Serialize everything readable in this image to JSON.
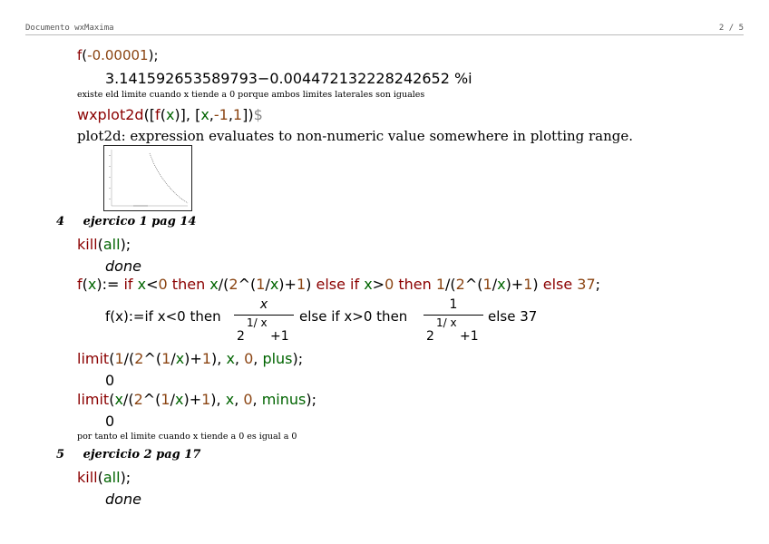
{
  "header": {
    "title": "Documento wxMaxima",
    "page": "2 / 5"
  },
  "cell1": {
    "input": {
      "fn": "f",
      "p1": "(",
      "neg": "-",
      "num": "0.00001",
      "p2": ");"
    },
    "output": "3.141592653589793−0.004472132228242652 %i"
  },
  "comment1": "existe eld limite cuando x tiende a 0 porque ambos limites laterales son iguales",
  "cell2": {
    "input": {
      "fn": "wxplot2d",
      "a": "([",
      "f": "f",
      "b": "(",
      "x": "x",
      "c": ")], [",
      "x2": "x",
      "d": ",",
      "n1": "-1",
      "e": ",",
      "n2": "1",
      "g": "])",
      "dollar": "$"
    },
    "message": "plot2d: expression evaluates to non-numeric value somewhere in plotting range."
  },
  "section4": {
    "number": "4",
    "title": "ejercico 1  pag 14"
  },
  "cell3": {
    "input": {
      "fn": "kill",
      "p1": "(",
      "arg": "all",
      "p2": ");"
    },
    "output": "done"
  },
  "cell4": {
    "input": {
      "t1": "f",
      "t2": "(",
      "t3": "x",
      "t4": "):= ",
      "t5": "if",
      "t6": " ",
      "t7": "x",
      "t8": "<",
      "t9": "0",
      "t10": " then ",
      "t11": "x",
      "t12": "/(",
      "t13": "2",
      "t14": "^(",
      "t15": "1",
      "t16": "/",
      "t17": "x",
      "t18": ")+",
      "t19": "1",
      "t20": ") ",
      "t21": "else if",
      "t22": " ",
      "t23": "x",
      "t24": ">",
      "t25": "0",
      "t26": " then ",
      "t27": "1",
      "t28": "/(",
      "t29": "2",
      "t30": "^(",
      "t31": "1",
      "t32": "/",
      "t33": "x",
      "t34": ")+",
      "t35": "1",
      "t36": ") ",
      "t37": "else ",
      "t38": "37",
      "t39": ";"
    },
    "output": {
      "lhs": "f(x):=if x<0 then",
      "frac1_num": "x",
      "frac1_base": "2",
      "frac1_exp": "1/ x",
      "frac1_plus": "+1",
      "mid": "else if x>0 then",
      "frac2_num": "1",
      "frac2_base": "2",
      "frac2_exp": "1/ x",
      "frac2_plus": "+1",
      "rhs": "else 37"
    }
  },
  "cell5": {
    "input": {
      "fn": "limit",
      "a": "(",
      "n1": "1",
      "b": "/(",
      "n2": "2",
      "c": "^(",
      "n3": "1",
      "d": "/",
      "x": "x",
      "e": ")+",
      "n4": "1",
      "f": "), ",
      "x2": "x",
      "g": ", ",
      "n5": "0",
      "h": ", ",
      "dir": "plus",
      "i": ");"
    },
    "output": "0"
  },
  "cell6": {
    "input": {
      "fn": "limit",
      "a": "(",
      "x": "x",
      "b": "/(",
      "n2": "2",
      "c": "^(",
      "n3": "1",
      "d": "/",
      "x2": "x",
      "e": ")+",
      "n4": "1",
      "f": "), ",
      "x3": "x",
      "g": ", ",
      "n5": "0",
      "h": ", ",
      "dir": "minus",
      "i": ");"
    },
    "output": "0"
  },
  "comment2": "por tanto el limite cuando x tiende a 0 es igual a 0",
  "section5": {
    "number": "5",
    "title": "ejercicio 2 pag 17"
  },
  "cell7": {
    "input": {
      "fn": "kill",
      "p1": "(",
      "arg": "all",
      "p2": ");"
    },
    "output": "done"
  }
}
